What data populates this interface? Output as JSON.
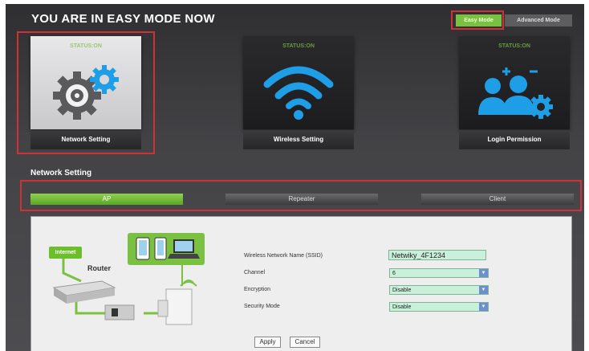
{
  "header": {
    "title": "YOU ARE IN EASY MODE NOW",
    "easy_mode_label": "Easy Mode",
    "advanced_mode_label": "Advanced Mode"
  },
  "tiles": [
    {
      "status": "STATUS:ON",
      "caption": "Network Setting",
      "icon": "gear-icon"
    },
    {
      "status": "STATUS:ON",
      "caption": "Wireless Setting",
      "icon": "wifi-icon"
    },
    {
      "status": "STATUS:ON",
      "caption": "Login Permission",
      "icon": "users-settings-icon"
    }
  ],
  "network": {
    "section_title": "Network Setting",
    "modes": [
      "AP",
      "Repeater",
      "Client"
    ]
  },
  "panel": {
    "internet_label": "Internet",
    "router_label": "Router",
    "fields": [
      {
        "label": "Wireless Network Name (SSID)",
        "value": "Netwiky_4F1234"
      },
      {
        "label": "Channel",
        "value": "6"
      },
      {
        "label": "Encryption",
        "value": "Disable"
      },
      {
        "label": "Security Mode",
        "value": "Disable"
      }
    ],
    "apply_label": "Apply",
    "cancel_label": "Cancel"
  },
  "colors": {
    "accent_green": "#7ac142",
    "highlight_red": "#d0303a",
    "icon_blue": "#1e9ee6"
  }
}
